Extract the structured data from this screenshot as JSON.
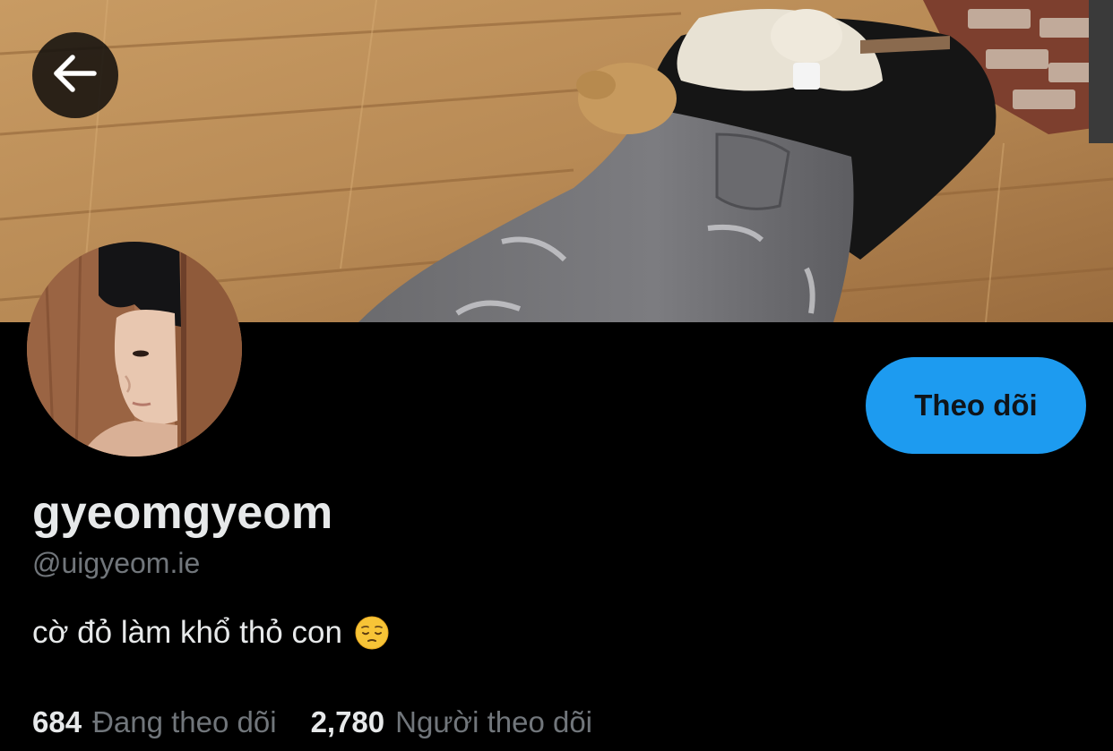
{
  "profile": {
    "display_name": "gyeomgyeom",
    "handle": "@uigyeom.ie",
    "bio": "cờ đỏ làm khổ thỏ con",
    "bio_emoji": "pensive-face-emoji",
    "follow_label": "Theo dõi"
  },
  "stats": {
    "following_count": "684",
    "following_label": "Đang theo dõi",
    "followers_count": "2,780",
    "followers_label": "Người theo dõi"
  },
  "icons": {
    "back": "arrow-left-icon"
  },
  "colors": {
    "background": "#000000",
    "accent": "#1d9bf0",
    "primary_text": "#e7e9ea",
    "secondary_text": "#71767b"
  }
}
